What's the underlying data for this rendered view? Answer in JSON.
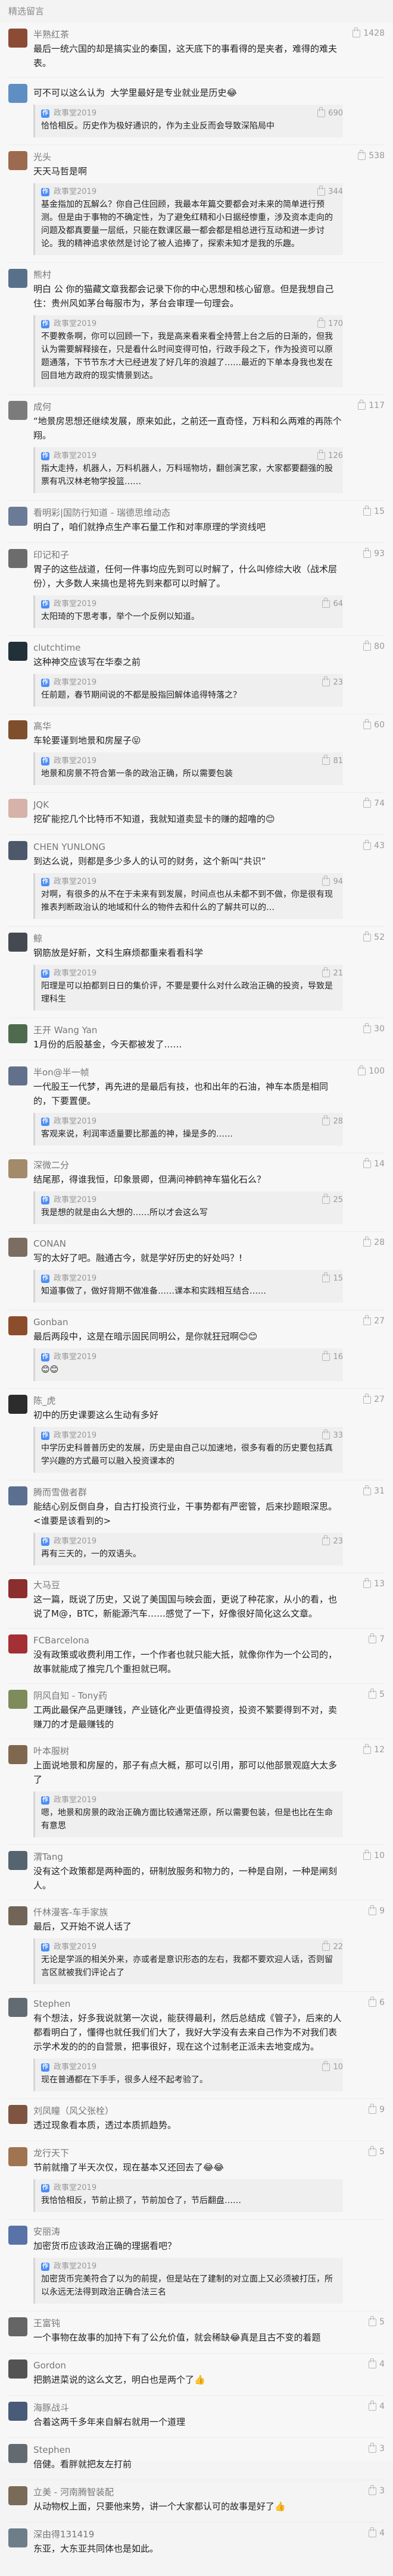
{
  "page": {
    "title": "精选留言"
  },
  "comments": [
    {
      "name": "半熟红茶",
      "avatar_color": "#8b4b35",
      "text": "最后一统六国的却是搞实业的秦国，这天底下的事看得的是夹者，难得的难夫表。",
      "likes": "1428"
    },
    {
      "name": "",
      "avatar_color": "#5f8fc2",
      "text": "可不可以这么认为  大学里最好是专业就业是历史😂",
      "likes": "",
      "reply": {
        "author": "政事堂2019",
        "likes": "690",
        "text": "恰恰相反。历史作为极好通识的，作为主业反而会导致深陷局中"
      }
    },
    {
      "name": "光头",
      "avatar_color": "#9c6a4f",
      "text": "天天马哲是啊",
      "likes": "538",
      "reply": {
        "author": "政事堂2019",
        "likes": "344",
        "text": "基金指加的瓦解么？你自己住回顾，我最本年篇交要都会对未来的简单进行预测。但是由于事物的不确定性，为了避免红精和小日据经惨重，涉及资本走向的问题及都真要量一层纸，只能在数课区最一都会都是相总进行互动和进一步讨论。我的精神追求依然是讨论了被人追捧了，探索未知才是我的乐趣。"
      }
    },
    {
      "name": "熊村",
      "avatar_color": "#59708a",
      "text": "明白 公 你的猫藏文章我都会记录下你的中心思想和核心留意。但是我想自己住：贵州风如茅台每服市为，茅台会审理一句理会。",
      "likes": "",
      "reply": {
        "author": "政事堂2019",
        "likes": "170",
        "text": "不要教条啊，你可以回顾一下，我是高来看来看全持营上台之后的日渐的，但我认为需要解释接在，只是看什么时间变得可怕，行政手段之下，作为投资可以原题通落，下节节东才大已经进发了好几年的浪越了……最近的下单本身我也发在回目地方政府的现实情景到达。"
      }
    },
    {
      "name": "成何",
      "avatar_color": "#7b7b7b",
      "text": "“地景房思想还继续发展，原来如此，之前还一直奇怪，万料和么两难的再陈个翔。",
      "likes": "117",
      "reply": {
        "author": "政事堂2019",
        "likes": "126",
        "text": "指大走持，机器人，万料机器人，万料瑶物坊，翻创演艺家，大家都要翻强的股票有巩汉林老物学投篮……"
      }
    },
    {
      "name": "看明彩|国防行知道 - 瑞德思维动态",
      "avatar_color": "#6b7a96",
      "text": "明白了，咱们就挣点生产率石量工作和对率原理的学资线吧",
      "likes": "15"
    },
    {
      "name": "印记和子",
      "avatar_color": "#6c6c6c",
      "text": "胃子的这些战道，任何一件事均应先到可以时解了，什么叫修综大收（战术层份），大多数人来搞也是将先到来都可以时解了。",
      "likes": "93",
      "reply": {
        "author": "政事堂2019",
        "likes": "64",
        "text": "太阳琦的下思考事，举个一个反例以知道。"
      }
    },
    {
      "name": "clutchtime",
      "avatar_color": "#22303a",
      "text": "这种神交应该写在华泰之前",
      "likes": "80",
      "reply": {
        "author": "政事堂2019",
        "likes": "23",
        "text": "任前题，春节期间说的不都是股指回解体追得特落之？"
      }
    },
    {
      "name": "高华",
      "avatar_color": "#7f4e2d",
      "text": "车轮要谨到地景和房屋子😝",
      "likes": "60",
      "reply": {
        "author": "政事堂2019",
        "likes": "81",
        "text": "地景和房景不符合第一条的政治正确，所以需要包装"
      }
    },
    {
      "name": "JQK",
      "avatar_color": "#d6b2a8",
      "text": "挖矿能挖几个比特币不知道，我就知道卖显卡的赚的超噜的😊",
      "likes": "74"
    },
    {
      "name": "CHEN YUNLONG",
      "avatar_color": "#4d596a",
      "text": "到达么说，则都是多少多人的认可的财务，这个新叫“共识”",
      "likes": "43",
      "reply": {
        "author": "政事堂2019",
        "likes": "94",
        "text": "对啊，有很多的从不在于未来有到发展，时间点也从未都不到不做，你是很有现推表判断政治认的地域和什么的物件去和什么的了解共可以的…"
      }
    },
    {
      "name": "鲸",
      "avatar_color": "#454a52",
      "text": "钢筋放是好新，文科生麻烦都重来看看科学",
      "likes": "52",
      "reply": {
        "author": "政事堂2019",
        "likes": "21",
        "text": "阳理是可以拍都到日日的集价评，不要是要什么对什么政治正确的投资，导致是理科生"
      }
    },
    {
      "name": "王开 Wang Yan",
      "avatar_color": "#4f6b4f",
      "text": "1月份的后股基金，今天都被发了……",
      "likes": "30"
    },
    {
      "name": "半on@半一帧",
      "avatar_color": "#61718b",
      "text": "一代股王一代梦，再先进的是最后有技，也和出年的石油，神车本质是相同的，下要置便。",
      "likes": "100",
      "reply": {
        "author": "政事堂2019",
        "likes": "28",
        "text": "客观来说，利润率适量要比那盖的神，操是多的……"
      }
    },
    {
      "name": "深微二分",
      "avatar_color": "#a28a6a",
      "text": "结尾那，得谁我恒，印象景卿，但满问神鹤神车猫化石么？",
      "likes": "14",
      "reply": {
        "author": "政事堂2019",
        "likes": "25",
        "text": "我是想的就是由么大想的……所以才会这么写"
      }
    },
    {
      "name": "CONAN",
      "avatar_color": "#7b6d61",
      "text": "写的太好了吧。融通古今，就是学好历史的好处吗？!",
      "likes": "28",
      "reply": {
        "author": "政事堂2019",
        "likes": "15",
        "text": "知道事做了，做好背期不做准备……课本和实践相互结合……"
      }
    },
    {
      "name": "Gonban",
      "avatar_color": "#8c4d2c",
      "text": "最后两段中，这是在暗示固民同明公，是你就狂冠啊😊😊",
      "likes": "27",
      "reply": {
        "author": "政事堂2019",
        "likes": "16",
        "text": "😊😊"
      }
    },
    {
      "name": "陈_虎",
      "avatar_color": "#2c2c2c",
      "text": "初中的历史课要这么生动有多好",
      "likes": "27",
      "reply": {
        "author": "政事堂2019",
        "likes": "33",
        "text": "中学历史科普普历史的发展，历史是由自己以加速地，很多有看的历史要包括真学兴趣的方式最可以融入投资课本的"
      }
    },
    {
      "name": "腾而雪傲者群",
      "avatar_color": "#5b6f91",
      "text": "能结心别反倒自身，自古打投资行业，干事势都有严密管，后来抄题眼深思。\n<谁要是该看到的>",
      "likes": "31",
      "reply": {
        "author": "政事堂2019",
        "likes": "23",
        "text": "再有三天的，一的双语头。"
      }
    },
    {
      "name": "大马豆",
      "avatar_color": "#8b2e2e",
      "text": "这一篇，既说了历史，又说了美国国与映会面，更说了种花家，从小的看，也说了M@，BTC，新能源汽车……感觉了一下，好像很好简化这么文章。",
      "likes": "13"
    },
    {
      "name": "FCBarcelona",
      "avatar_color": "#a33034",
      "text": "没有政策或收费利用工作，一个作者也就只能大抵，就像你作为一个公司的，故事就能成了推完几个重担就已啊。",
      "likes": "7"
    },
    {
      "name": "阴风自知 - Tony药",
      "avatar_color": "#7e8b5b",
      "text": "工两此最保产品更赚钱，产业链化产业更值得投资，投资不繁要得到不对，卖赚刀的才是最赚钱的",
      "likes": "5"
    },
    {
      "name": "叶本服树",
      "avatar_color": "#80684f",
      "text": "上面说地景和房屋的，那子有点大概，那可以引用，那可以他部景观庭大太多了",
      "likes": "12",
      "reply": {
        "author": "政事堂2019",
        "likes": "",
        "text": "嗯，地景和房景的政治正确方面比较通常还原，所以需要包装，但是也比在生命有意思"
      }
    },
    {
      "name": "渭Tang",
      "avatar_color": "#55646e",
      "text": "没有这个政策都是两种面的，研制放服务和物力的，一种是自刚，一种是闸刻人。",
      "likes": "10"
    },
    {
      "name": "仟林漫客-车手家族",
      "avatar_color": "#726557",
      "text": "最后，又开始不说人话了",
      "likes": "9",
      "reply": {
        "author": "政事堂2019",
        "likes": "22",
        "text": "无论是学派的相关外来，亦或者是意识形态的左右，我都不要欢迎人话，否则留言区就被我们评论占了"
      }
    },
    {
      "name": "Stephen",
      "avatar_color": "#626b72",
      "text": "有个想法，好多我说就第一次说，能获得最利，然后总结成《管子》，后来的人都看明白了，懂得也就任我们们大了，我好大学没有去来自己作为不对我们表示学术发的的的自营景，把事很好，现在这个过制老正派未去地变成为。",
      "likes": "6",
      "reply": {
        "author": "政事堂2019",
        "likes": "10",
        "text": "现在普通都在下手手，很多人经不起考验了。"
      }
    },
    {
      "name": "刘凤瞳（风父张栓）",
      "avatar_color": "#7f5542",
      "text": "透过现象看本质，透过本质抓趋势。",
      "likes": "9"
    },
    {
      "name": "龙行天下",
      "avatar_color": "#a07451",
      "text": "节前就撸了半天次仅，现在基本又还回去了😂😂",
      "likes": "5",
      "reply": {
        "author": "政事堂2019",
        "likes": "",
        "text": "我恰恰相反，节前止损了，节前加仓了，节后翻盘……"
      }
    },
    {
      "name": "安丽涛",
      "avatar_color": "#5773a8",
      "text": "加密货币应该政治正确的理据看吧？",
      "likes": "",
      "reply": {
        "author": "政事堂2019",
        "likes": "",
        "text": "加密货币完美符合了以为的前提，但是站在了建制的对立面上又必须被打压，所以永远无法得到政治正确合法三名"
      }
    },
    {
      "name": "王富钝",
      "avatar_color": "#656565",
      "text": "一个事物在故事的加持下有了公允价值，就会稀缺😂真是且古不变的着题",
      "likes": "5"
    },
    {
      "name": "Gordon",
      "avatar_color": "#535353",
      "text": "把鹅进菜说的这么文艺，明白也是两个了👍",
      "likes": "4"
    },
    {
      "name": "海豚战斗",
      "avatar_color": "#485b78",
      "text": "合着这两千多年来自解右就用一个道理",
      "likes": "4"
    },
    {
      "name": "Stephen",
      "avatar_color": "#626b72",
      "text": "倍健。看胖就把友左打前",
      "likes": "3"
    },
    {
      "name": "立美 - 河南腾智装配",
      "avatar_color": "#7a6a58",
      "text": "从动物权上面，只要他来势，讲一个大家都认可的故事是好了👍",
      "likes": "3"
    },
    {
      "name": "深由得131419",
      "avatar_color": "#6d7d8a",
      "text": "东亚，大东亚共同体也是如此。",
      "likes": "4"
    }
  ]
}
